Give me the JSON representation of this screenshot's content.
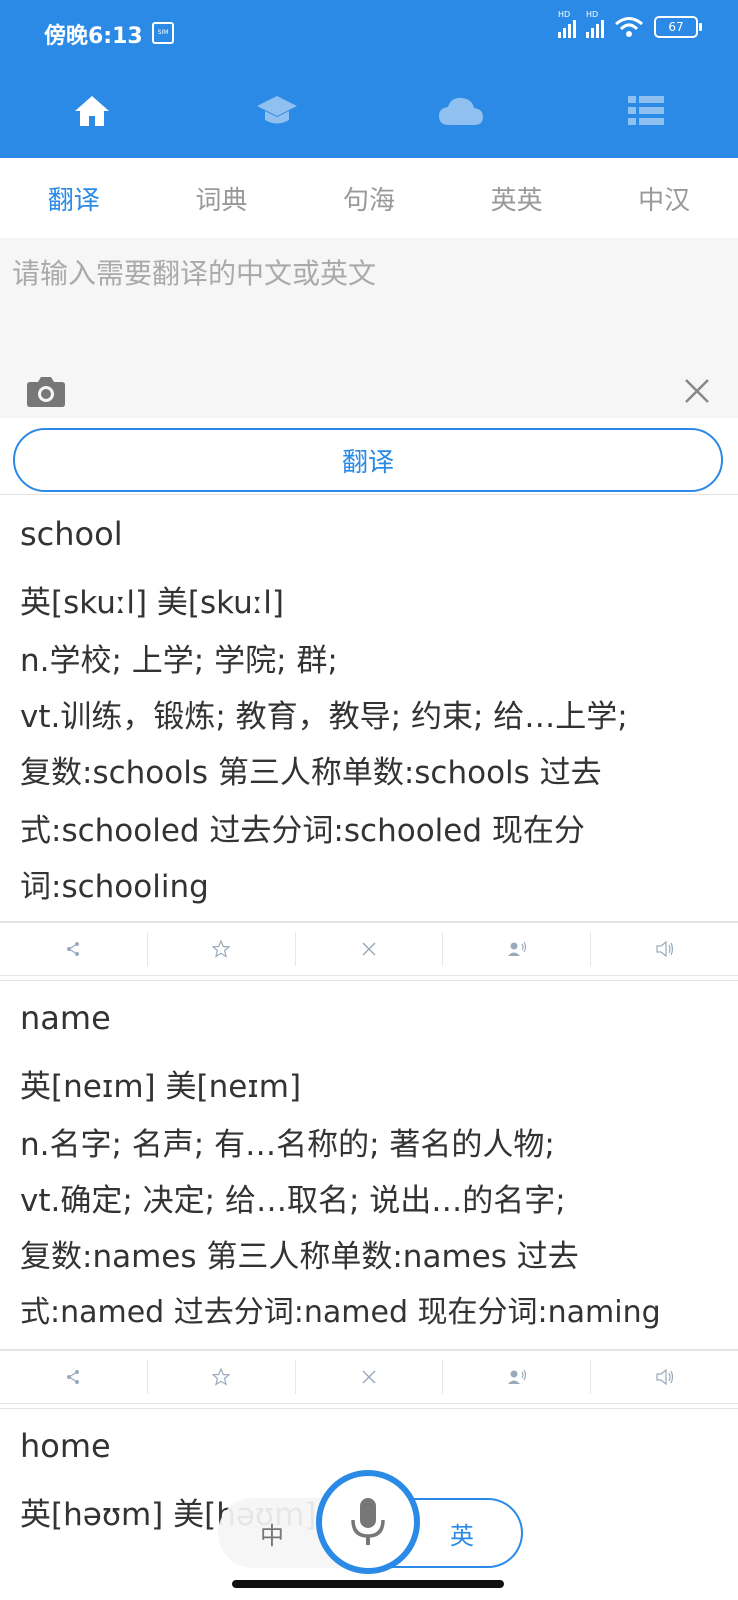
{
  "status_bar": {
    "time": "傍晚6:13",
    "sim_label": "SIM",
    "signal_label_1": "HD",
    "signal_label_2": "HD",
    "battery": "67"
  },
  "nav": {
    "items": [
      {
        "icon": "home-icon",
        "active": true
      },
      {
        "icon": "graduation-cap-icon",
        "active": false
      },
      {
        "icon": "cloud-icon",
        "active": false
      },
      {
        "icon": "list-icon",
        "active": false
      }
    ]
  },
  "tabs": [
    {
      "label": "翻译",
      "active": true
    },
    {
      "label": "词典",
      "active": false
    },
    {
      "label": "句海",
      "active": false
    },
    {
      "label": "英英",
      "active": false
    },
    {
      "label": "中汉",
      "active": false
    }
  ],
  "input": {
    "placeholder": "请输入需要翻译的中文或英文"
  },
  "translate_button": "翻译",
  "results": [
    {
      "word": "school",
      "lines": [
        "英[skuːl]  美[skuːl]",
        "n.学校; 上学; 学院; 群;",
        "vt.训练，锻炼; 教育，教导; 约束; 给…上学;",
        "复数:schools  第三人称单数:schools  过去",
        "式:schooled  过去分词:schooled  现在分",
        "词:schooling"
      ]
    },
    {
      "word": "name",
      "lines": [
        "英[neɪm]  美[neɪm]",
        "n.名字; 名声; 有…名称的; 著名的人物;",
        "vt.确定; 决定; 给…取名; 说出…的名字;",
        "复数:names  第三人称单数:names  过去",
        "式:named  过去分词:named  现在分词:naming"
      ]
    },
    {
      "word": "home",
      "lines": [
        "英[həʊm]  美[həʊm]"
      ]
    }
  ],
  "voice": {
    "left_label": "中",
    "right_label": "英"
  },
  "colors": {
    "primary": "#2a8ae6",
    "icon_gray": "#9ab"
  }
}
